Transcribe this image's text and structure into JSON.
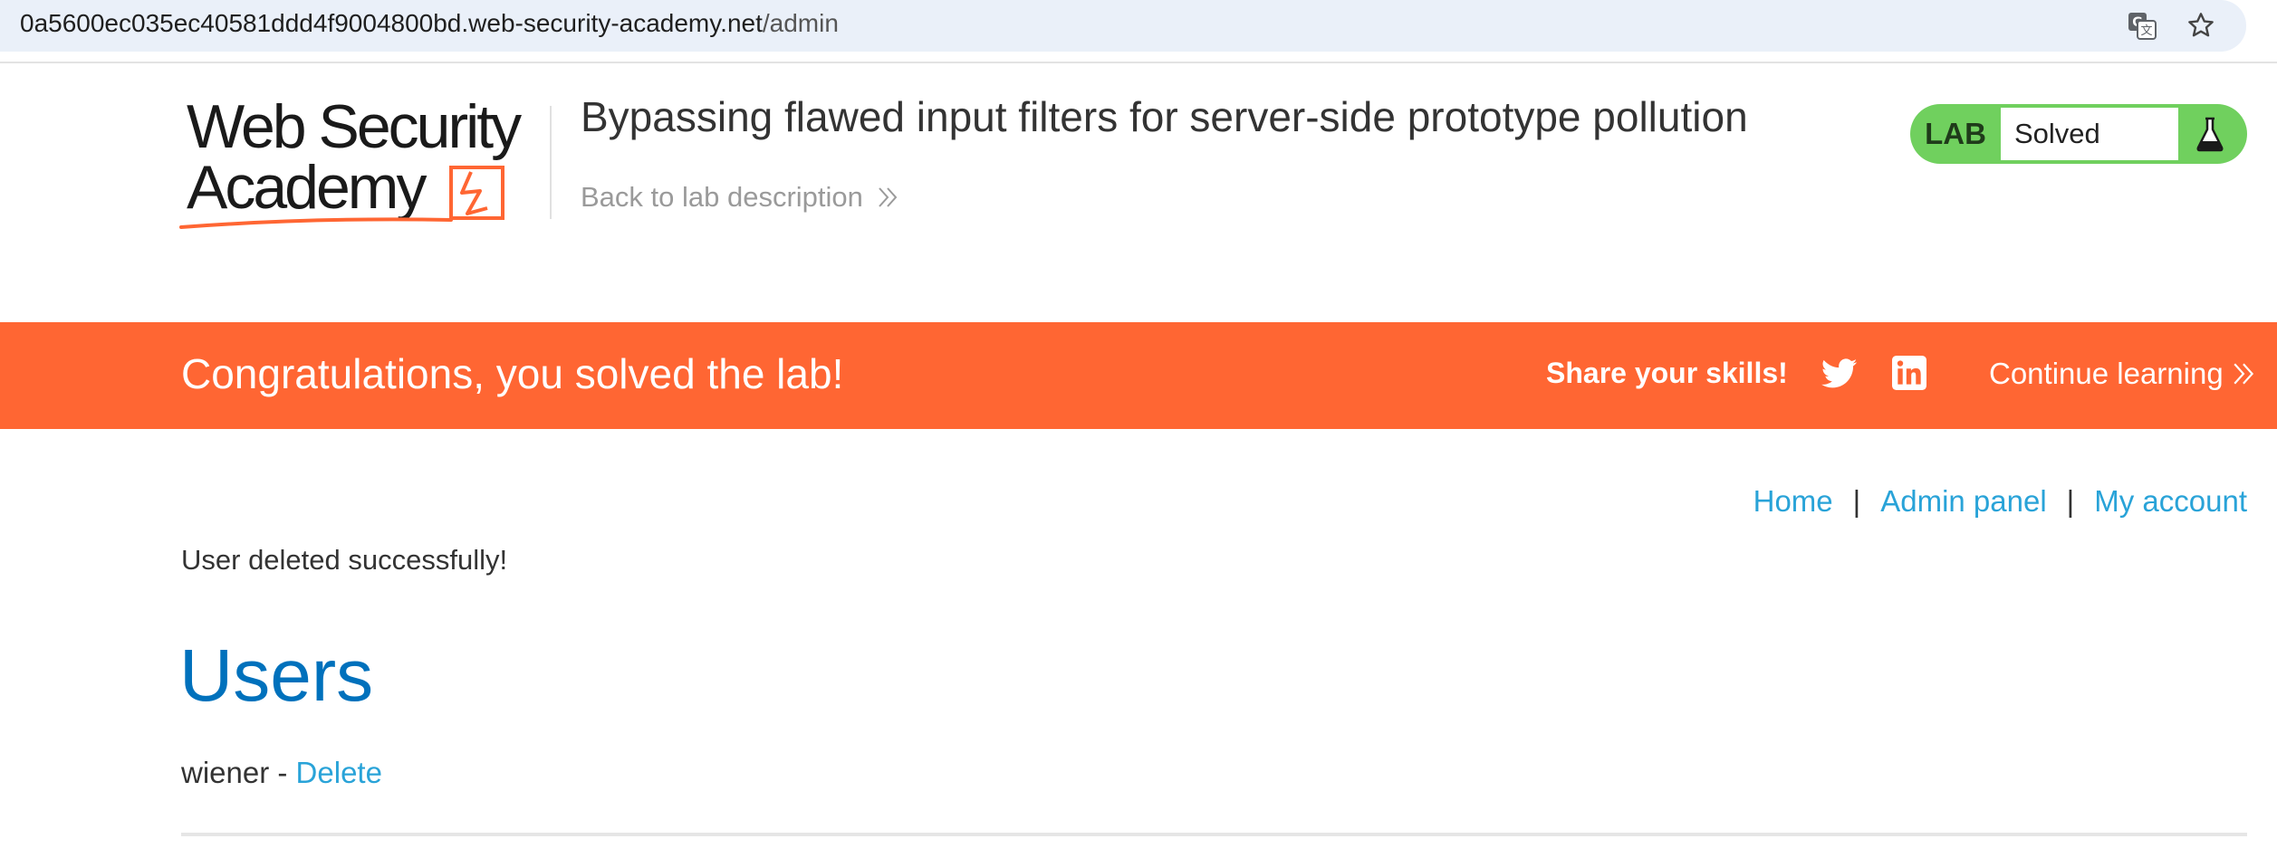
{
  "browser": {
    "url_host": "0a5600ec035ec40581ddd4f9004800bd.web-security-academy.net",
    "url_path": "/admin",
    "icons": [
      "translate-icon",
      "bookmark-star-icon"
    ]
  },
  "header": {
    "logo_line1": "Web Security",
    "logo_line2": "Academy",
    "lab_title": "Bypassing flawed input filters for server-side prototype pollution",
    "back_link": "Back to lab description",
    "lab_badge": {
      "label": "LAB",
      "status": "Solved",
      "icon": "flask-icon"
    }
  },
  "banner": {
    "message": "Congratulations, you solved the lab!",
    "share_label": "Share your skills!",
    "social_icons": [
      "twitter-icon",
      "linkedin-icon"
    ],
    "continue_link": "Continue learning"
  },
  "nav": {
    "home": "Home",
    "admin_panel": "Admin panel",
    "my_account": "My account",
    "separator": "|"
  },
  "main": {
    "notice": "User deleted successfully!",
    "heading": "Users",
    "users": [
      {
        "name": "wiener",
        "separator": " - ",
        "action": "Delete"
      }
    ]
  },
  "colors": {
    "banner": "#ff6633",
    "link": "#29a3d8",
    "heading": "#0071bc",
    "lab_badge": "#70d05e",
    "logo_accent": "#ff6633"
  }
}
